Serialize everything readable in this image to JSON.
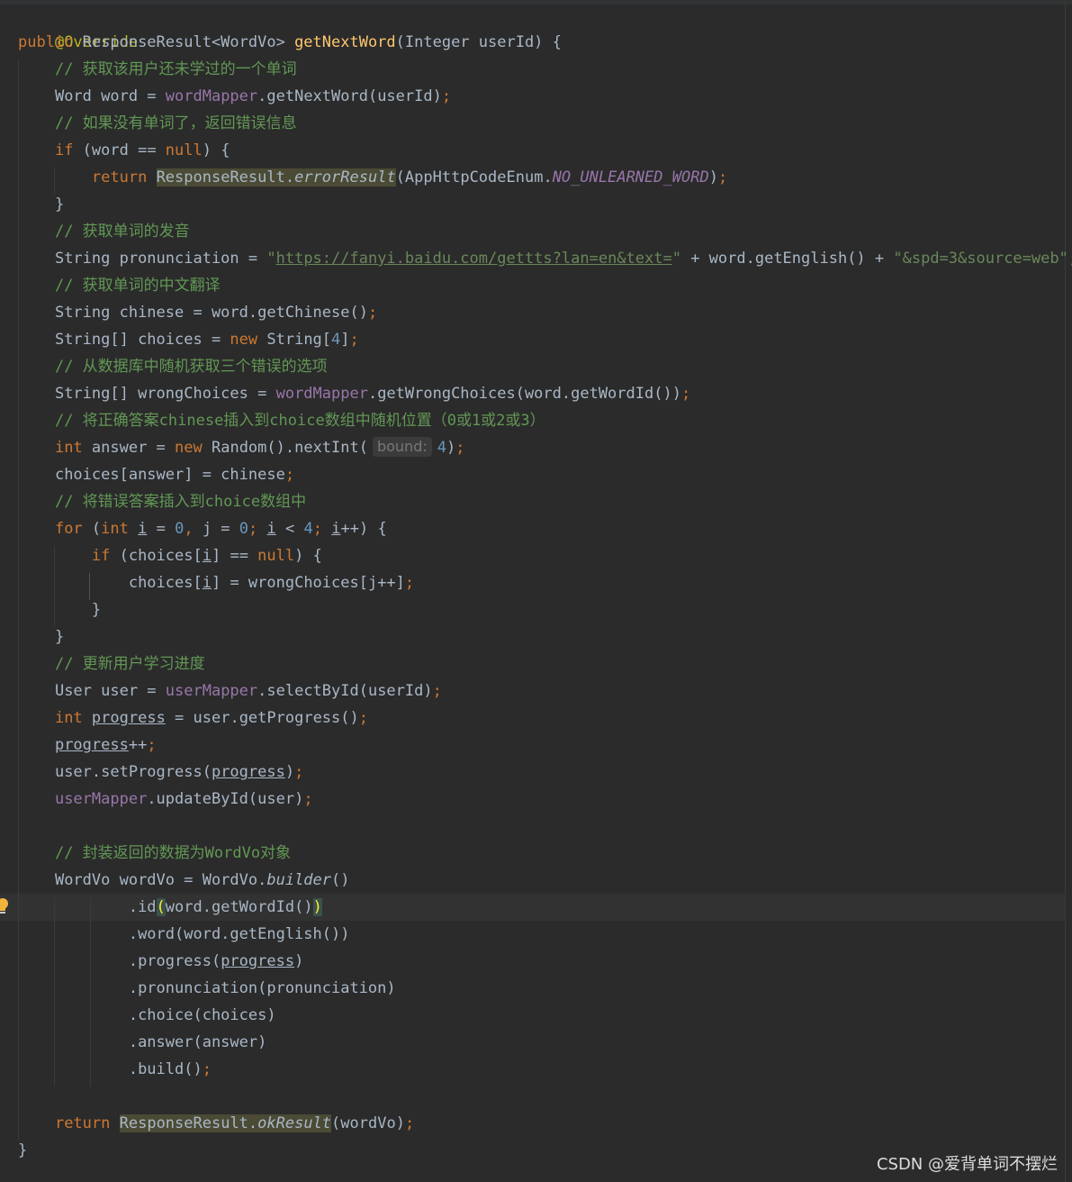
{
  "code": {
    "l01": "@Override",
    "l02_public": "public",
    "l02_type": " ResponseResult<WordVo> ",
    "l02_method": "getNextWord",
    "l02_rest": "(Integer userId) {",
    "l03": "// 获取该用户还未学过的一个单词",
    "l04_a": "Word word = ",
    "l04_b": "wordMapper",
    "l04_c": ".getNextWord(userId)",
    "l05": "// 如果没有单词了，返回错误信息",
    "l06_if": "if",
    "l06_a": " (word == ",
    "l06_null": "null",
    "l06_b": ") {",
    "l07_return": "return",
    "l07_class": "ResponseResult.",
    "l07_method": "errorResult",
    "l07_a": "(AppHttpCodeEnum.",
    "l07_const": "NO_UNLEARNED_WORD",
    "l07_b": ")",
    "l08": "}",
    "l09": "// 获取单词的发音",
    "l10_a": "String pronunciation = ",
    "l10_q1": "\"",
    "l10_url": "https://fanyi.baidu.com/gettts?lan=en&text=",
    "l10_q2": "\"",
    "l10_b": " + word.getEnglish() + ",
    "l10_str": "\"&spd=3&source=web\"",
    "l11": "// 获取单词的中文翻译",
    "l12": "String chinese = word.getChinese()",
    "l13_a": "String[] choices = ",
    "l13_new": "new",
    "l13_b": " String[",
    "l13_num": "4",
    "l13_c": "]",
    "l14": "// 从数据库中随机获取三个错误的选项",
    "l15_a": "String[] wrongChoices = ",
    "l15_b": "wordMapper",
    "l15_c": ".getWrongChoices(word.getWordId())",
    "l16": "// 将正确答案chinese插入到choice数组中随机位置（0或1或2或3）",
    "l17_int": "int",
    "l17_a": " answer = ",
    "l17_new": "new",
    "l17_b": " Random().nextInt(",
    "l17_hint": "bound:",
    "l17_num": "4",
    "l17_c": ")",
    "l18": "choices[answer] = chinese",
    "l19": "// 将错误答案插入到choice数组中",
    "l20_for": "for",
    "l20_a": " (",
    "l20_int": "int",
    "l20_i1": "i",
    "l20_b": " = ",
    "l20_n0": "0",
    "l20_j": " j = ",
    "l20_n1": "0",
    "l20_i2": "i",
    "l20_c": " < ",
    "l20_n4": "4",
    "l20_i3": "i",
    "l20_d": "++) {",
    "l21_if": "if",
    "l21_a": " (choices[",
    "l21_i": "i",
    "l21_b": "] == ",
    "l21_null": "null",
    "l21_c": ") {",
    "l22_a": "choices[",
    "l22_i": "i",
    "l22_b": "] = wrongChoices[j++]",
    "l23": "}",
    "l24": "}",
    "l25": "// 更新用户学习进度",
    "l26_a": "User user = ",
    "l26_b": "userMapper",
    "l26_c": ".selectById(userId)",
    "l27_int": "int",
    "l27_var": "progress",
    "l27_a": " = user.getProgress()",
    "l28_var": "progress",
    "l28_a": "++",
    "l29_a": "user.setProgress(",
    "l29_var": "progress",
    "l29_b": ")",
    "l30_a": "userMapper",
    "l30_b": ".updateById(user)",
    "l31": "// 封装返回的数据为WordVo对象",
    "l32_a": "WordVo wordVo = WordVo.",
    "l32_method": "builder",
    "l32_b": "()",
    "l33_a": ".id",
    "l33_p1": "(",
    "l33_b": "word.getWordId()",
    "l33_p2": ")",
    "l34": ".word(word.getEnglish())",
    "l35_a": ".progress(",
    "l35_var": "progress",
    "l35_b": ")",
    "l36": ".pronunciation(pronunciation)",
    "l37": ".choice(choices)",
    "l38": ".answer(answer)",
    "l39": ".build()",
    "l40_return": "return",
    "l40_class": "ResponseResult.",
    "l40_method": "okResult",
    "l40_a": "(wordVo)",
    "l41": "}",
    "semi": ";",
    "comma": ","
  },
  "watermark": "CSDN @爱背单词不摆烂",
  "icons": {
    "gutter": "intention-bulb-icon"
  },
  "colors": {
    "background": "#2b2b2b",
    "keyword": "#cc7832",
    "comment": "#629755",
    "string": "#6a8759",
    "number": "#6897bb",
    "field": "#9876aa",
    "method_decl": "#ffc66d",
    "annotation": "#bbb529",
    "text": "#a9b7c6"
  }
}
